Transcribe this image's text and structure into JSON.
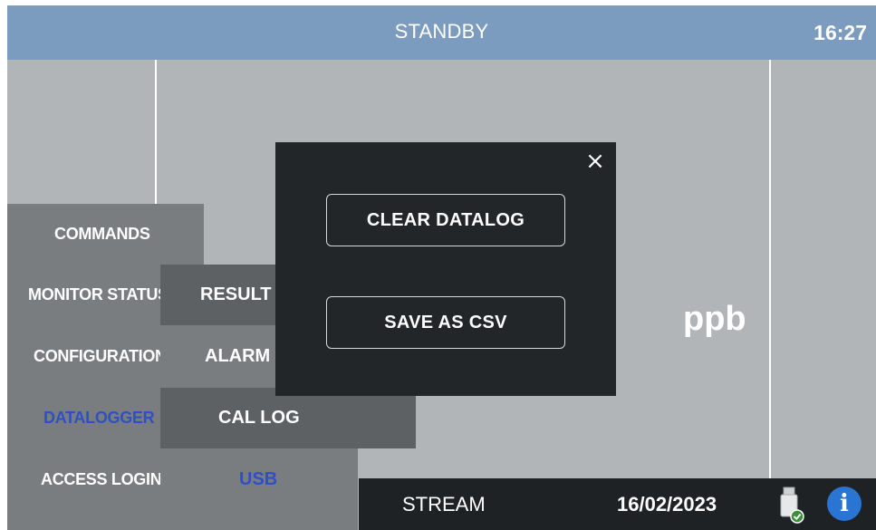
{
  "header": {
    "status": "STANDBY",
    "time": "16:27"
  },
  "main": {
    "unit": "ppb"
  },
  "menu": {
    "items": [
      {
        "label": "COMMANDS"
      },
      {
        "label": "MONITOR STATUS"
      },
      {
        "label": "CONFIGURATION"
      },
      {
        "label": "DATALOGGER",
        "active": true
      },
      {
        "label": "ACCESS LOGIN"
      }
    ]
  },
  "submenu": {
    "items": [
      {
        "label": "RESULT LOG"
      },
      {
        "label": "ALARM LOG"
      },
      {
        "label": "CAL LOG"
      },
      {
        "label": "USB",
        "active": true
      }
    ]
  },
  "dialog": {
    "close": "×",
    "clear_label": "CLEAR DATALOG",
    "save_label": "SAVE AS CSV"
  },
  "footer": {
    "stream": "STREAM",
    "date": "16/02/2023",
    "info_glyph": "i",
    "icons": [
      "usb-drive-icon",
      "info-icon"
    ]
  },
  "colors": {
    "header": "#7b9bbf",
    "active_text": "#2f4fc9",
    "info": "#2a74d4"
  }
}
